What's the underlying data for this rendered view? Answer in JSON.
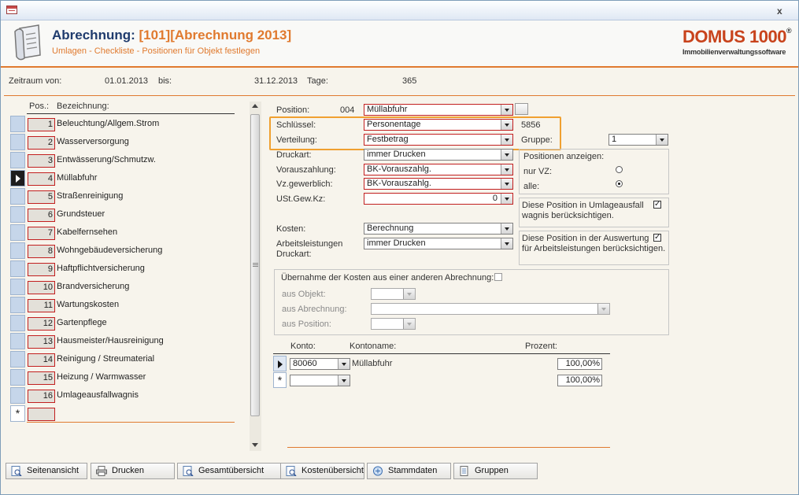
{
  "header": {
    "title_prefix": "Abrechnung:",
    "title_code": "[101][Abrechnung 2013]",
    "subtitle": "Umlagen - Checkliste - Positionen für Objekt festlegen",
    "brand": "DOMUS 1000",
    "brand_reg": "®",
    "brand_sub": "Immobilienverwaltungssoftware"
  },
  "window": {
    "close_label": "x"
  },
  "period": {
    "von_label": "Zeitraum von:",
    "von_value": "01.01.2013",
    "bis_label": "bis:",
    "bis_value": "31.12.2013",
    "tage_label": "Tage:",
    "tage_value": "365"
  },
  "list": {
    "col_pos": "Pos.:",
    "col_bez": "Bezeichnung:",
    "new_marker": "*",
    "rows": [
      {
        "pos": "1",
        "label": "Beleuchtung/Allgem.Strom"
      },
      {
        "pos": "2",
        "label": "Wasserversorgung"
      },
      {
        "pos": "3",
        "label": "Entwässerung/Schmutzw."
      },
      {
        "pos": "4",
        "label": "Müllabfuhr"
      },
      {
        "pos": "5",
        "label": "Straßenreinigung"
      },
      {
        "pos": "6",
        "label": "Grundsteuer"
      },
      {
        "pos": "7",
        "label": "Kabelfernsehen"
      },
      {
        "pos": "8",
        "label": "Wohngebäudeversicherung"
      },
      {
        "pos": "9",
        "label": "Haftpflichtversicherung"
      },
      {
        "pos": "10",
        "label": "Brandversicherung"
      },
      {
        "pos": "11",
        "label": "Wartungskosten"
      },
      {
        "pos": "12",
        "label": "Gartenpflege"
      },
      {
        "pos": "13",
        "label": "Hausmeister/Hausreinigung"
      },
      {
        "pos": "14",
        "label": "Reinigung / Streumaterial"
      },
      {
        "pos": "15",
        "label": "Heizung / Warmwasser"
      },
      {
        "pos": "16",
        "label": "Umlageausfallwagnis"
      }
    ]
  },
  "form": {
    "position_label": "Position:",
    "position_nr": "004",
    "position_value": "Müllabfuhr",
    "schluessel_label": "Schlüssel:",
    "schluessel_value": "Personentage",
    "schluessel_code": "5856",
    "verteilung_label": "Verteilung:",
    "verteilung_value": "Festbetrag",
    "gruppe_label": "Gruppe:",
    "gruppe_value": "1",
    "druckart_label": "Druckart:",
    "druckart_value": "immer Drucken",
    "vorauszahlung_label": "Vorauszahlung:",
    "vorauszahlung_value": "BK-Vorauszahlg.",
    "vzgew_label": "Vz.gewerblich:",
    "vzgew_value": "BK-Vorauszahlg.",
    "ustgew_label": "USt.Gew.Kz:",
    "ustgew_value": "0",
    "kosten_label": "Kosten:",
    "kosten_value": "Berechnung",
    "arb_label_1": "Arbeitsleistungen",
    "arb_label_2": "Druckart:",
    "arb_value": "immer Drucken"
  },
  "positionen": {
    "title": "Positionen anzeigen:",
    "opt_vz": "nur VZ:",
    "opt_alle": "alle:"
  },
  "checks": {
    "umlage_1": "Diese Position in Umlageausfall",
    "umlage_2": "wagnis berücksichtigen.",
    "auswertung_1": "Diese Position in der Auswertung",
    "auswertung_2": "für Arbeitsleistungen berücksichtigen.",
    "checked_mark": "✓"
  },
  "uebernahme": {
    "title": "Übernahme der Kosten aus einer anderen Abrechnung:",
    "objekt_label": "aus Objekt:",
    "abrechnung_label": "aus Abrechnung:",
    "position_label": "aus Position:"
  },
  "konto": {
    "col_konto": "Konto:",
    "col_name": "Kontoname:",
    "col_prozent": "Prozent:",
    "rows": [
      {
        "konto": "80060",
        "name": "Müllabfuhr",
        "prozent": "100,00%"
      },
      {
        "konto": "",
        "name": "",
        "prozent": "100,00%"
      }
    ],
    "new_marker": "*"
  },
  "buttons": [
    {
      "label": "Seitenansicht",
      "icon": "page-view-icon"
    },
    {
      "label": "Drucken",
      "icon": "print-icon"
    },
    {
      "label": "Gesamtübersicht",
      "icon": "overview-icon"
    },
    {
      "label": "Kostenübersicht",
      "icon": "cost-overview-icon"
    },
    {
      "label": "Stammdaten",
      "icon": "master-data-icon"
    },
    {
      "label": "Gruppen",
      "icon": "groups-icon"
    }
  ],
  "colors": {
    "accent": "#e07a2f",
    "title_blue": "#1f3b6d",
    "highlight": "#f0a030",
    "required": "#c21f1f"
  }
}
